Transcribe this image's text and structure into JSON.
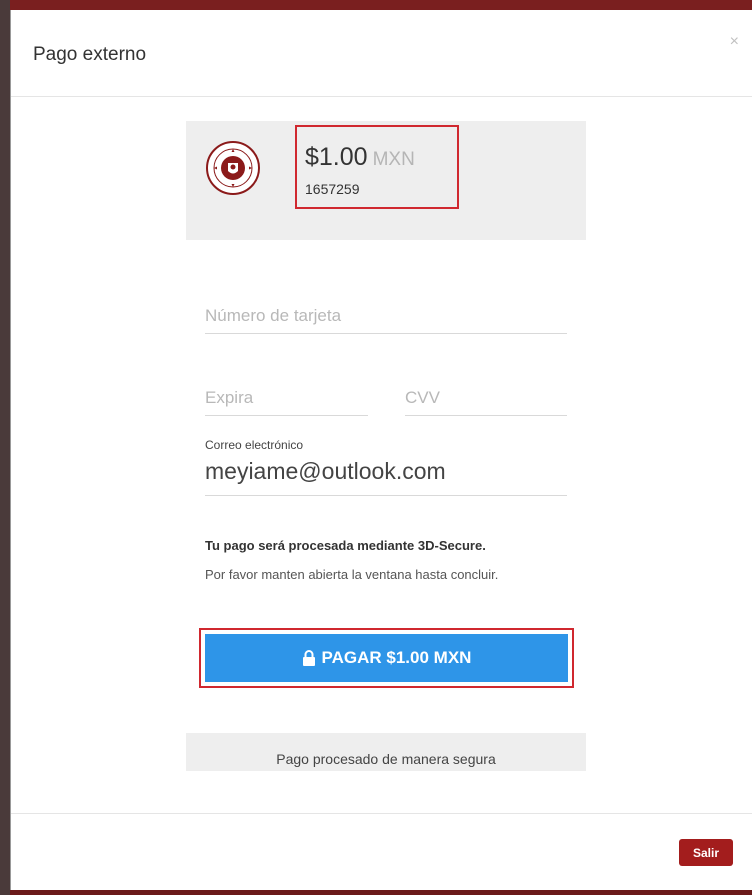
{
  "modal": {
    "title": "Pago externo",
    "close_symbol": "×"
  },
  "summary": {
    "logo_icon": "university-seal-icon",
    "amount": "$1.00",
    "currency": "MXN",
    "reference": "1657259"
  },
  "form": {
    "card_number": {
      "placeholder": "Número de tarjeta",
      "value": ""
    },
    "expiry": {
      "placeholder": "Expira",
      "value": ""
    },
    "cvv": {
      "placeholder": "CVV",
      "value": ""
    },
    "email": {
      "label": "Correo electrónico",
      "value": "meyiame@outlook.com"
    }
  },
  "notice": {
    "bold": "Tu pago será procesada mediante 3D-Secure.",
    "text": "Por favor manten abierta la ventana hasta concluir."
  },
  "pay_button": {
    "icon": "lock-icon",
    "label": "PAGAR $1.00 MXN",
    "color": "#2e95e8"
  },
  "secure_footer": "Pago procesado de manera segura",
  "footer": {
    "exit_label": "Salir",
    "exit_color": "#a31d1d"
  },
  "colors": {
    "highlight_border": "#d0282f",
    "seal": "#8b1a1a"
  }
}
